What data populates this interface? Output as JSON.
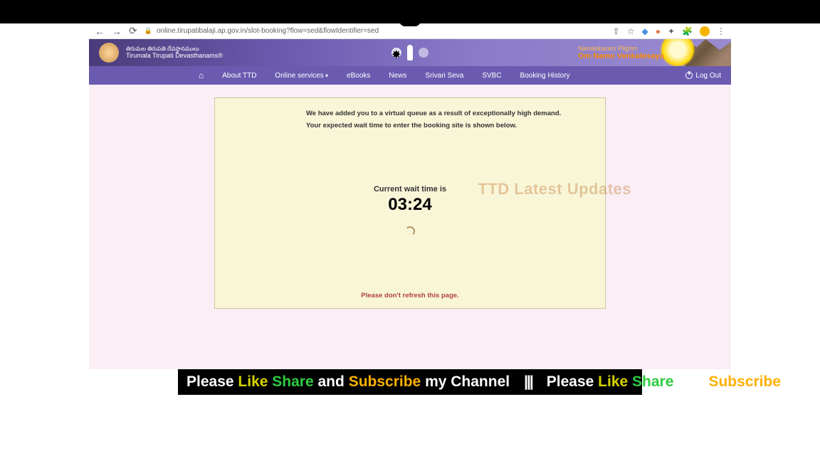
{
  "browser": {
    "url": "online.tirupatibalaji.ap.gov.in/slot-booking?flow=sed&flowIdentifier=sed"
  },
  "header": {
    "org_line1": "తిరుమల తిరుపతి దేవస్థానములు",
    "org_line2": "Tirumala Tirupati Devasthanams®",
    "greeting_line1": "Namaskaram Pilgrim",
    "greeting_line2": "Om Namo Venkatesaya"
  },
  "nav": {
    "items": [
      {
        "label": "About TTD"
      },
      {
        "label": "Online services"
      },
      {
        "label": "eBooks"
      },
      {
        "label": "News"
      },
      {
        "label": "Srivari Seva"
      },
      {
        "label": "SVBC"
      },
      {
        "label": "Booking History"
      }
    ],
    "logout": "Log Out"
  },
  "queue": {
    "msg1": "We have added you to a virtual queue as a result of exceptionally high demand.",
    "msg2": "Your expected wait time to enter the booking site is shown below.",
    "wait_label": "Current wait time is",
    "wait_time": "03:24",
    "no_refresh": "Please don't refresh this page."
  },
  "watermark": "TTD Latest Updates",
  "banner": {
    "please": "Please",
    "like": "Like",
    "share": "Share",
    "and": "and",
    "subscribe": "Subscribe",
    "tail": "my Channel",
    "divider": "|||"
  }
}
